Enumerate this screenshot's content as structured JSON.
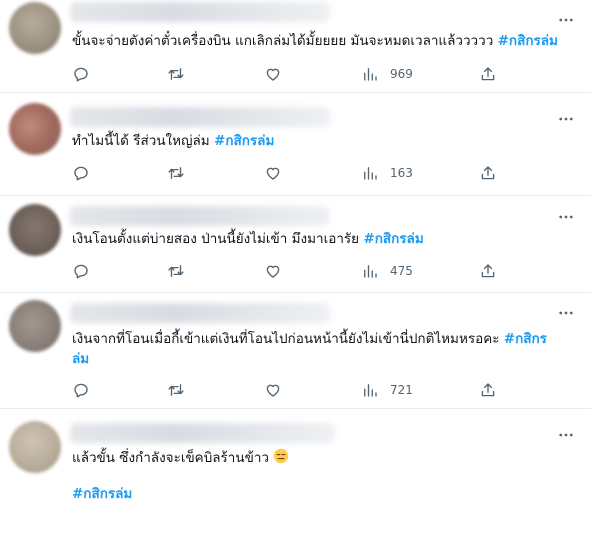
{
  "tweets": [
    {
      "text": "ขั้นจะจ่ายตังค่าตั๋วเครื่องบิน แกเลิกล่มได้มั้ยยยย มันจะหมดเวลาแล้ววววว",
      "hashtag": "#กสิกรล่ม",
      "views": "969",
      "avatar_color": "#9a9081"
    },
    {
      "text": "ทำไมนี้ได้ รีส่วนใหญ่ล่ม",
      "hashtag": "#กสิกรล่ม",
      "views": "163",
      "avatar_color": "#a0685d"
    },
    {
      "text": "เงินโอนตั้งแต่บ่ายสอง ป่านนี้ยังไม่เข้า มึงมาเอารัย",
      "hashtag": "#กสิกรล่ม",
      "views": "475",
      "avatar_color": "#6e625a"
    },
    {
      "text": "เงินจากที่โอนเมื่อกี้เข้าแต่เงินที่โอนไปก่อนหน้านี้ยังไม่เข้านี่ปกติไหมหรอคะ",
      "hashtag_line1": "#กสิกร",
      "hashtag_line2": "ล่ม",
      "views": "721",
      "avatar_color": "#8a8079"
    },
    {
      "text": "แล้วขั้น ซึ่งกำลังจะเข็คบิลร้านข้าว",
      "emoji": "expressionless-face-emoji",
      "hashtag": "#กสิกรล่ม",
      "avatar_color": "#b9ad9c"
    }
  ],
  "icons": {
    "reply": "reply-icon",
    "retweet": "retweet-icon",
    "like": "like-icon",
    "views": "views-icon",
    "share": "share-icon",
    "more": "more-icon"
  },
  "colors": {
    "hashtag": "#1d9bf0",
    "icon": "#536471",
    "divider": "#e6ecf0"
  }
}
